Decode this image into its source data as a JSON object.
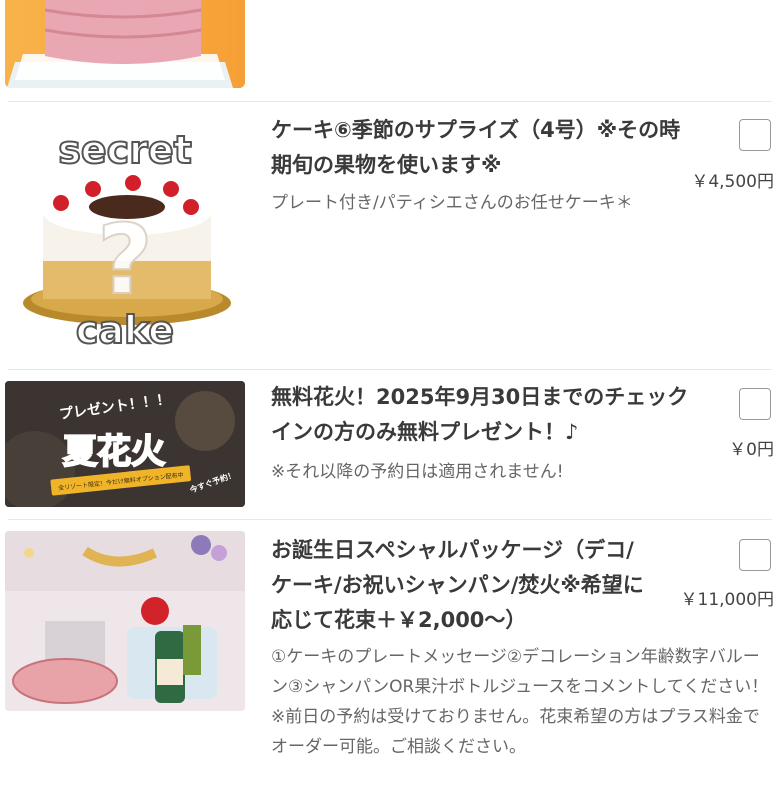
{
  "items": [
    {
      "title": "ケーキ⑥季節のサプライズ（4号）※その時期旬の果物を使います※",
      "description": "プレート付き/パティシエさんのお任せケーキ＊",
      "price": "￥4,500円",
      "image": {
        "top_word": "secret",
        "bottom_word": "cake"
      }
    },
    {
      "title": "無料花火！2025年9月30日までのチェックインの方のみ無料プレゼント！♪",
      "description": "※それ以降の予約日は適用されません!",
      "price": "￥0円",
      "image": {
        "banner": "プレゼント！！！",
        "main": "夏花火",
        "ribbon": "全リゾート限定！今だけ無料オプション配布中",
        "tag": "今すぐ予約！"
      }
    },
    {
      "title": "お誕生日スペシャルパッケージ（デコ/ケーキ/お祝いシャンパン/焚火※希望に応じて花束＋￥2,000〜）",
      "description": "①ケーキのプレートメッセージ②デコレーション年齢数字バルーン③シャンパンOR果汁ボトルジュースをコメントしてください！※前日の予約は受けておりません。花束希望の方はプラス料金でオーダー可能。ご相談ください。",
      "price": "￥11,000円"
    }
  ]
}
